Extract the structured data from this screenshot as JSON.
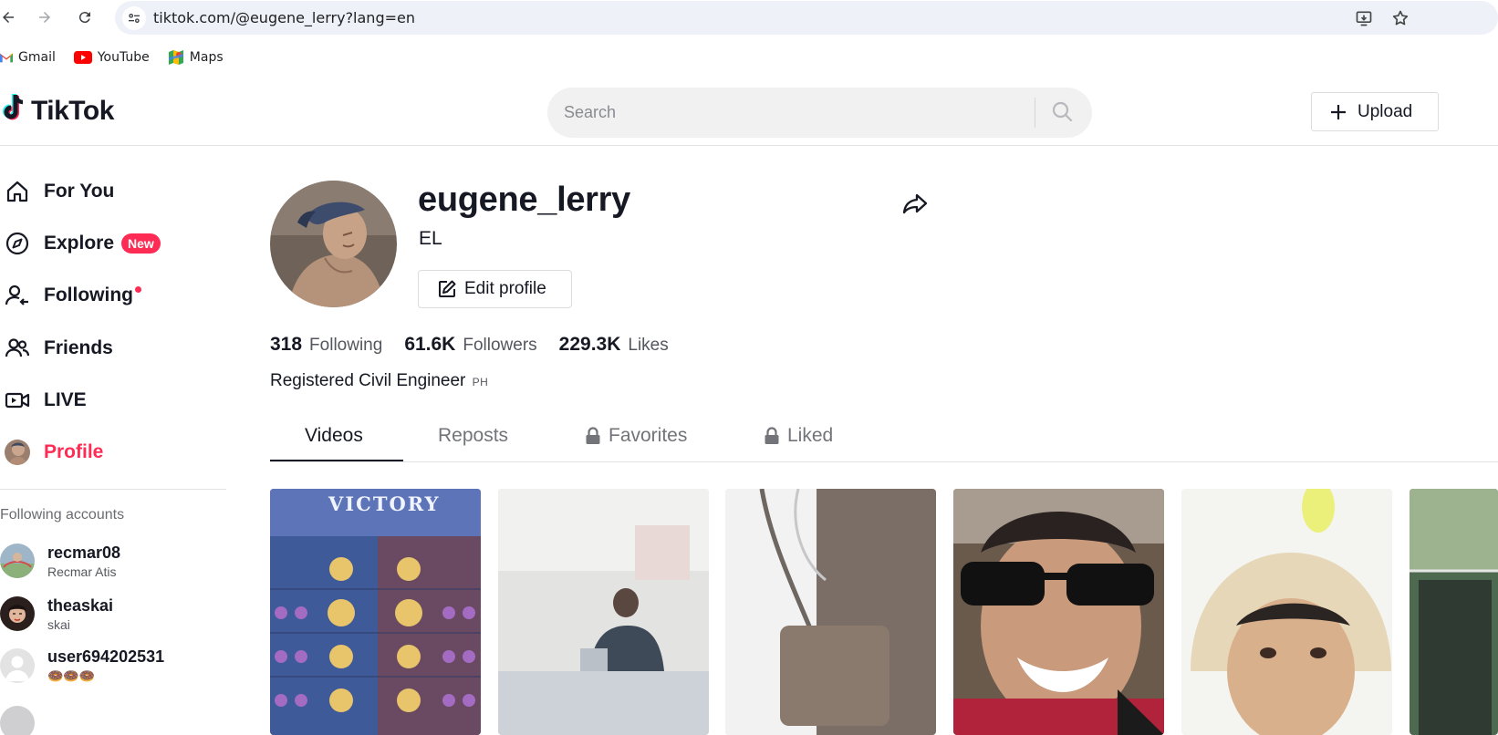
{
  "browser": {
    "url": "tiktok.com/@eugene_lerry?lang=en",
    "bookmarks": [
      {
        "label": "Gmail",
        "icon": "gmail-icon"
      },
      {
        "label": "YouTube",
        "icon": "youtube-icon"
      },
      {
        "label": "Maps",
        "icon": "maps-icon"
      }
    ]
  },
  "header": {
    "logo_text": "TikTok",
    "search_placeholder": "Search",
    "upload_label": "Upload"
  },
  "sidebar": {
    "items": [
      {
        "label": "For You",
        "icon": "home-icon"
      },
      {
        "label": "Explore",
        "icon": "compass-icon",
        "badge": "New"
      },
      {
        "label": "Following",
        "icon": "following-icon"
      },
      {
        "label": "Friends",
        "icon": "friends-icon"
      },
      {
        "label": "LIVE",
        "icon": "live-icon"
      },
      {
        "label": "Profile",
        "icon": "profile-avatar-icon"
      }
    ],
    "following_title": "Following accounts",
    "accounts": [
      {
        "username": "recmar08",
        "nickname": "Recmar Atis"
      },
      {
        "username": "theaskai",
        "nickname": "skai"
      },
      {
        "username": "user694202531",
        "nickname": "🍩🍩🍩"
      }
    ]
  },
  "profile": {
    "username": "eugene_lerry",
    "nickname": "EL",
    "edit_label": "Edit profile",
    "stats": [
      {
        "value": "318",
        "label": "Following"
      },
      {
        "value": "61.6K",
        "label": "Followers"
      },
      {
        "value": "229.3K",
        "label": "Likes"
      }
    ],
    "bio": "Registered Civil Engineer",
    "bio_flag": "PH"
  },
  "tabs": [
    {
      "label": "Videos",
      "locked": false,
      "active": true
    },
    {
      "label": "Reposts",
      "locked": false,
      "active": false
    },
    {
      "label": "Favorites",
      "locked": true,
      "active": false
    },
    {
      "label": "Liked",
      "locked": true,
      "active": false
    }
  ],
  "videos": {
    "first_thumb_text": "VICTORY",
    "colors": [
      "#5a6fa8",
      "#dcdcdc",
      "#d8d8d8",
      "#7a5a48",
      "#efefea",
      "#6f8a6a"
    ]
  },
  "colors": {
    "accent": "#fe2c55",
    "text": "#161823"
  }
}
